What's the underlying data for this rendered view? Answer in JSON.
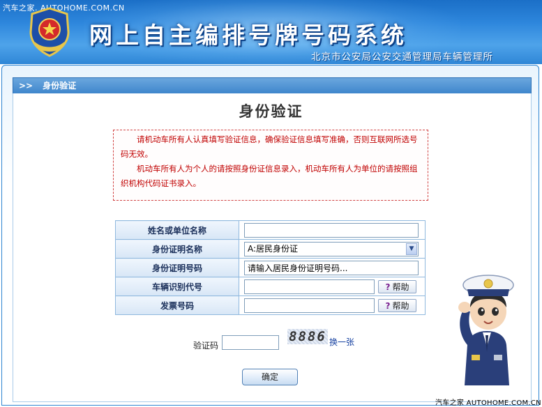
{
  "watermark_top": "汽车之家. AUTOHOME.COM.CN",
  "header": {
    "title": "网上自主编排号牌号码系统",
    "organization": "北京市公安局公安交通管理局车辆管理所"
  },
  "section": {
    "arrow": ">>",
    "label": "身份验证"
  },
  "page_title": "身份验证",
  "notice": {
    "p1": "请机动车所有人认真填写验证信息，确保验证信息填写准确，否则互联网所选号码无效。",
    "p2": "机动车所有人为个人的请按照身份证信息录入，机动车所有人为单位的请按照组织机构代码证书录入。"
  },
  "form": {
    "rows": [
      {
        "label": "姓名或单位名称",
        "value": ""
      },
      {
        "label": "身份证明名称",
        "selected": "A:居民身份证"
      },
      {
        "label": "身份证明号码",
        "value": "请输入居民身份证明号码..."
      },
      {
        "label": "车辆识别代号",
        "value": "",
        "help": "帮助"
      },
      {
        "label": "发票号码",
        "value": "",
        "help": "帮助"
      }
    ],
    "help_icon": "question-mark-icon"
  },
  "captcha": {
    "label": "验证码",
    "value": "",
    "image_text": "8886",
    "refresh": "换一张"
  },
  "confirm_button": "确定",
  "watermark_bottom": "汽车之家 AUTOHOME.COM.CN",
  "colors": {
    "header_blue": "#2d86dc",
    "notice_red": "#c00000",
    "label_text": "#1a2f5a"
  }
}
